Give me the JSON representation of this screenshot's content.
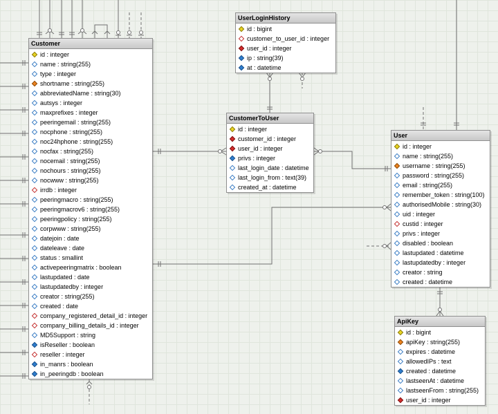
{
  "tables": {
    "customer": {
      "name": "Customer",
      "columns": [
        {
          "label": "id : integer",
          "key": "pk"
        },
        {
          "label": "name : string(255)",
          "key": "nul"
        },
        {
          "label": "type : integer",
          "key": "nul"
        },
        {
          "label": "shortname : string(255)",
          "key": "uq"
        },
        {
          "label": "abbreviatedName : string(30)",
          "key": "nul"
        },
        {
          "label": "autsys : integer",
          "key": "nul"
        },
        {
          "label": "maxprefixes : integer",
          "key": "nul"
        },
        {
          "label": "peeringemail : string(255)",
          "key": "nul"
        },
        {
          "label": "nocphone : string(255)",
          "key": "nul"
        },
        {
          "label": "noc24hphone : string(255)",
          "key": "nul"
        },
        {
          "label": "nocfax : string(255)",
          "key": "nul"
        },
        {
          "label": "nocemail : string(255)",
          "key": "nul"
        },
        {
          "label": "nochours : string(255)",
          "key": "nul"
        },
        {
          "label": "nocwww : string(255)",
          "key": "nul"
        },
        {
          "label": "irrdb : integer",
          "key": "nfk"
        },
        {
          "label": "peeringmacro : string(255)",
          "key": "nul"
        },
        {
          "label": "peeringmacrov6 : string(255)",
          "key": "nul"
        },
        {
          "label": "peeringpolicy : string(255)",
          "key": "nul"
        },
        {
          "label": "corpwww : string(255)",
          "key": "nul"
        },
        {
          "label": "datejoin : date",
          "key": "nul"
        },
        {
          "label": "dateleave : date",
          "key": "nul"
        },
        {
          "label": "status : smallint",
          "key": "nul"
        },
        {
          "label": "activepeeringmatrix : boolean",
          "key": "nul"
        },
        {
          "label": "lastupdated : date",
          "key": "nul"
        },
        {
          "label": "lastupdatedby : integer",
          "key": "nul"
        },
        {
          "label": "creator : string(255)",
          "key": "nul"
        },
        {
          "label": "created : date",
          "key": "nul"
        },
        {
          "label": "company_registered_detail_id : integer",
          "key": "nfk"
        },
        {
          "label": "company_billing_details_id : integer",
          "key": "nfk"
        },
        {
          "label": "MD5Support : string",
          "key": "nul"
        },
        {
          "label": "isReseller : boolean",
          "key": "col"
        },
        {
          "label": "reseller : integer",
          "key": "nfk"
        },
        {
          "label": "in_manrs : boolean",
          "key": "col"
        },
        {
          "label": "in_peeringdb : boolean",
          "key": "col"
        }
      ]
    },
    "user_login_history": {
      "name": "UserLoginHistory",
      "columns": [
        {
          "label": "id : bigint",
          "key": "pk"
        },
        {
          "label": "customer_to_user_id : integer",
          "key": "nfk"
        },
        {
          "label": "user_id : integer",
          "key": "fk"
        },
        {
          "label": "ip : string(39)",
          "key": "col"
        },
        {
          "label": "at : datetime",
          "key": "col"
        }
      ]
    },
    "customer_to_user": {
      "name": "CustomerToUser",
      "columns": [
        {
          "label": "id : integer",
          "key": "pk"
        },
        {
          "label": "customer_id : integer",
          "key": "fk"
        },
        {
          "label": "user_id : integer",
          "key": "fk"
        },
        {
          "label": "privs : integer",
          "key": "col"
        },
        {
          "label": "last_login_date : datetime",
          "key": "nul"
        },
        {
          "label": "last_login_from : text(39)",
          "key": "nul"
        },
        {
          "label": "created_at : datetime",
          "key": "nul"
        }
      ]
    },
    "user": {
      "name": "User",
      "columns": [
        {
          "label": "id : integer",
          "key": "pk"
        },
        {
          "label": "name : string(255)",
          "key": "nul"
        },
        {
          "label": "username : string(255)",
          "key": "uq"
        },
        {
          "label": "password : string(255)",
          "key": "nul"
        },
        {
          "label": "email : string(255)",
          "key": "nul"
        },
        {
          "label": "remember_token : string(100)",
          "key": "nul"
        },
        {
          "label": "authorisedMobile : string(30)",
          "key": "nul"
        },
        {
          "label": "uid : integer",
          "key": "nul"
        },
        {
          "label": "custid : integer",
          "key": "nfk"
        },
        {
          "label": "privs : integer",
          "key": "nul"
        },
        {
          "label": "disabled : boolean",
          "key": "nul"
        },
        {
          "label": "lastupdated : datetime",
          "key": "nul"
        },
        {
          "label": "lastupdatedby : integer",
          "key": "nul"
        },
        {
          "label": "creator : string",
          "key": "nul"
        },
        {
          "label": "created : datetime",
          "key": "nul"
        }
      ]
    },
    "api_key": {
      "name": "ApiKey",
      "columns": [
        {
          "label": "id : bigint",
          "key": "pk"
        },
        {
          "label": "apiKey : string(255)",
          "key": "uq"
        },
        {
          "label": "expires : datetime",
          "key": "nul"
        },
        {
          "label": "allowedIPs : text",
          "key": "nul"
        },
        {
          "label": "created : datetime",
          "key": "col"
        },
        {
          "label": "lastseenAt : datetime",
          "key": "nul"
        },
        {
          "label": "lastseenFrom : string(255)",
          "key": "nul"
        },
        {
          "label": "user_id : integer",
          "key": "fk"
        }
      ]
    }
  },
  "colors": {
    "primary_key": "#e8d422",
    "foreign_key": "#d42c2c",
    "unique": "#ee8420",
    "column": "#2f7fd0",
    "connector": "#707070"
  }
}
